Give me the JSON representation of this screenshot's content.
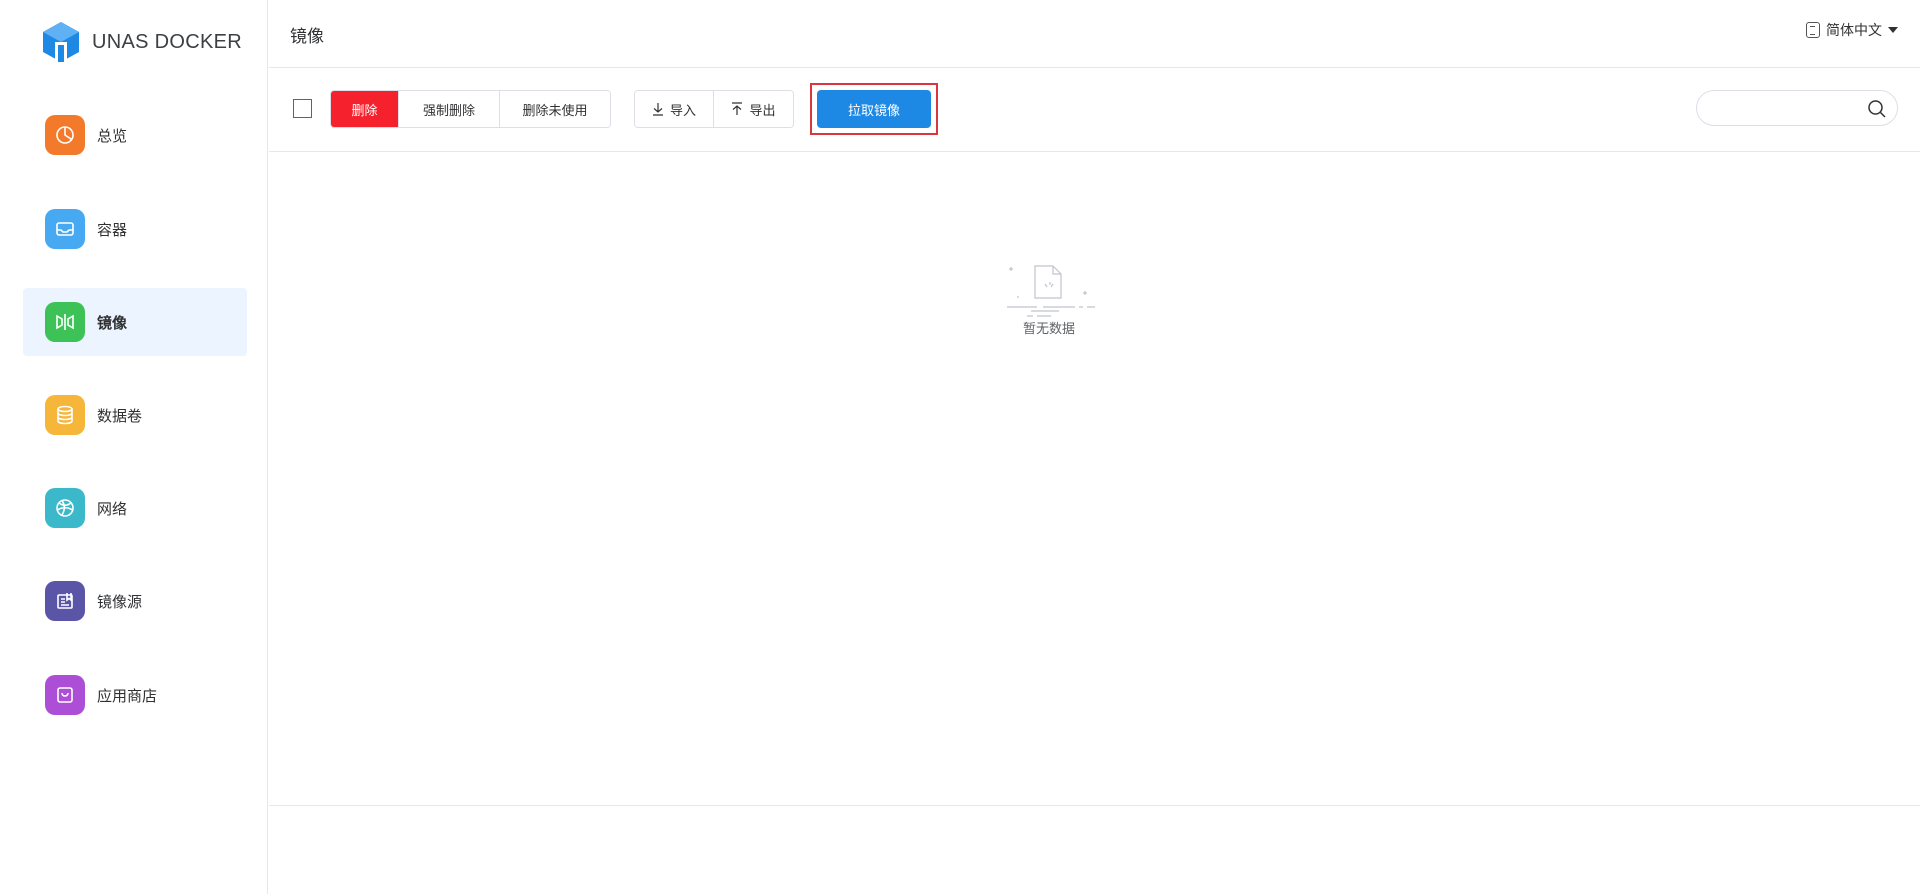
{
  "app": {
    "name": "UNAS DOCKER",
    "brand_color": "#1e88e5"
  },
  "sidebar": {
    "items": [
      {
        "label": "总览",
        "icon": "dashboard-icon",
        "color": "#f47a2b"
      },
      {
        "label": "容器",
        "icon": "container-icon",
        "color": "#47a9f2"
      },
      {
        "label": "镜像",
        "icon": "image-icon",
        "color": "#3cc257",
        "active": true
      },
      {
        "label": "数据卷",
        "icon": "database-icon",
        "color": "#f5b63a"
      },
      {
        "label": "网络",
        "icon": "network-icon",
        "color": "#3bb8c9"
      },
      {
        "label": "镜像源",
        "icon": "registry-icon",
        "color": "#5b55a8"
      },
      {
        "label": "应用商店",
        "icon": "store-icon",
        "color": "#ad4fd6"
      }
    ]
  },
  "header": {
    "title": "镜像",
    "language": "简体中文"
  },
  "toolbar": {
    "delete_label": "删除",
    "force_delete_label": "强制删除",
    "delete_unused_label": "删除未使用",
    "import_label": "导入",
    "export_label": "导出",
    "pull_label": "拉取镜像",
    "search_placeholder": ""
  },
  "content": {
    "empty_text": "暂无数据"
  }
}
